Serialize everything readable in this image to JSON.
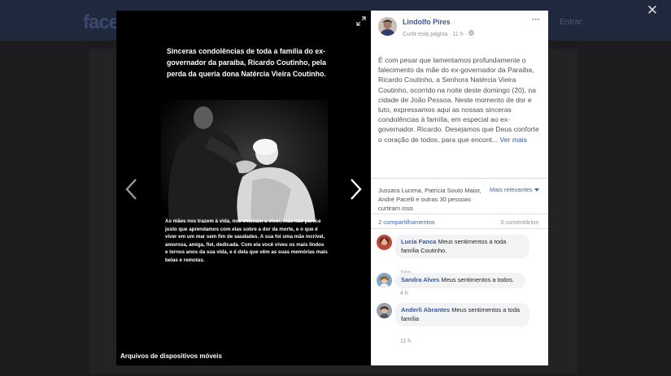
{
  "background": {
    "logo": "face",
    "right_link": "Entrar"
  },
  "viewer": {
    "close_glyph": "✕",
    "caption": "Arquivos de dispositivos móveis",
    "poster_title": "Sinceras condolências de toda a família do ex-governador da paraíba, Ricardo Coutinho, pela perda da queria dona Natércia Vieira Coutinho.",
    "poster_body": "As mães nos trazem à vida, nos ensinam a viver, mas não parece justo que aprendamos com elas sobre a dor da morte, e o que é viver em um mar sem fim de saudades. A sua foi uma mãe incrível, amorosa, amiga, fiel, dedicada. Com ela você viveu os mais lindos e ternos anos da sua vida, e é dela que vêm as suas memórias mais belas e remotas."
  },
  "post": {
    "author": "Lindolfo Pires",
    "like_page": "Curtir esta página",
    "time": "11 h",
    "text": "É com pesar que lamentamos profundamente o falecimento da mãe do ex-governador da Paraíba, Ricardo Coutinho, a Senhora Natércia Vieira Coutinho, ocorrido na noite deste domingo (20), na cidade de João Pessoa. Neste momento de dor e luto, expressamos aqui as nossas sinceras condolências à família, em especial ao ex-governador. Ricardo. Desejamos que Deus conforte o coração de todos, para que encont...",
    "see_more": "Ver mais",
    "likers": "Jussara Lucena, Patrícia Souto Maior, André Pacelli e outras 30 pessoas curtiram isso.",
    "relevance": "Mais relevantes",
    "shares": "2 compartilhamentos",
    "comments_count": "3 comentários"
  },
  "comments": [
    {
      "name": "Lucia Fanca",
      "text": "Meus sentimentos a toda família Coutinho.",
      "time": "24m"
    },
    {
      "name": "Sandra Alves",
      "text": "Meus sentimentos a todos.",
      "time": "4 h"
    },
    {
      "name": "Anderli Abrantes",
      "text": "Meus sentimentos a toda família",
      "time": "11 h"
    }
  ],
  "colors": {
    "link": "#385898",
    "accent": "#4267b2",
    "muted": "#90949c"
  }
}
